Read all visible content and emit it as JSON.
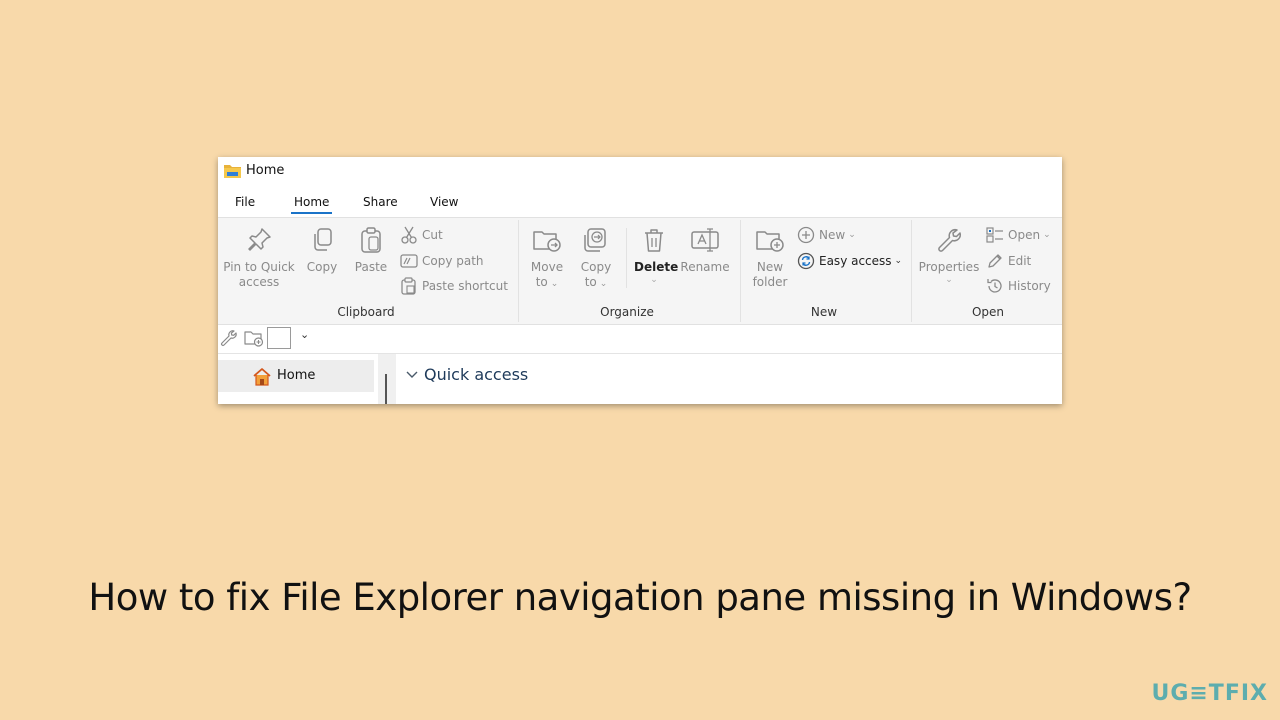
{
  "window": {
    "title": "Home",
    "tabs": [
      "File",
      "Home",
      "Share",
      "View"
    ],
    "active_tab": "Home"
  },
  "ribbon": {
    "clipboard": {
      "group_label": "Clipboard",
      "pin_label_1": "Pin to Quick",
      "pin_label_2": "access",
      "copy_label": "Copy",
      "paste_label": "Paste",
      "cut_label": "Cut",
      "copy_path_label": "Copy path",
      "paste_shortcut_label": "Paste shortcut"
    },
    "organize": {
      "group_label": "Organize",
      "move_label_1": "Move",
      "move_label_2": "to",
      "copyto_label_1": "Copy",
      "copyto_label_2": "to",
      "delete_label": "Delete",
      "rename_label": "Rename"
    },
    "new": {
      "group_label": "New",
      "new_folder_label_1": "New",
      "new_folder_label_2": "folder",
      "new_item_label": "New",
      "easy_access_label": "Easy access"
    },
    "open": {
      "group_label": "Open",
      "properties_label": "Properties",
      "open_label": "Open",
      "edit_label": "Edit",
      "history_label": "History"
    }
  },
  "navigation": {
    "home_label": "Home"
  },
  "content": {
    "quick_access_label": "Quick access"
  },
  "caption": "How to fix File Explorer navigation pane missing in Windows?",
  "watermark": "UG≡TFIX",
  "colors": {
    "background": "#f8d9aa",
    "accent": "#1a73c8",
    "watermark": "#2a9fb0"
  }
}
